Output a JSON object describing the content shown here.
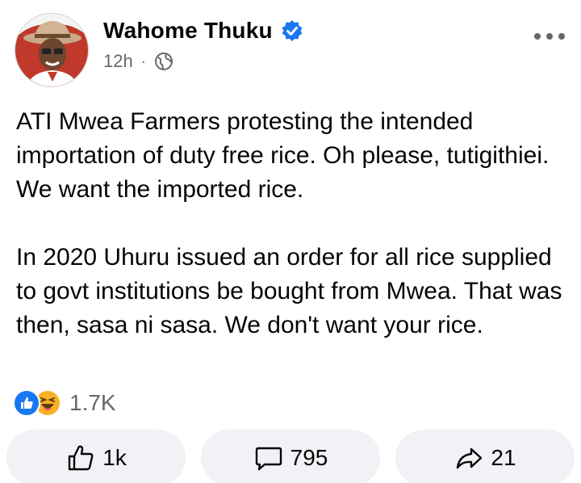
{
  "post": {
    "author": "Wahome Thuku",
    "verified_icon": "verified-badge-icon",
    "time": "12h",
    "separator": "·",
    "audience_icon": "globe-icon",
    "paragraphs": [
      "ATI Mwea Farmers protesting the intended importation of duty free rice. Oh please, tutigithiei. We want the imported rice.",
      "In 2020 Uhuru issued an order for all rice supplied to govt institutions be bought from Mwea. That was then, sasa ni sasa. We don't want your rice."
    ]
  },
  "reactions": {
    "icons": [
      "like-reaction-icon",
      "haha-reaction-icon"
    ],
    "count": "1.7K"
  },
  "actions": {
    "like_count": "1k",
    "comment_count": "795",
    "share_count": "21"
  },
  "colors": {
    "accent": "#1877f2",
    "muted": "#65676b",
    "button_bg": "#f0f2f5"
  }
}
